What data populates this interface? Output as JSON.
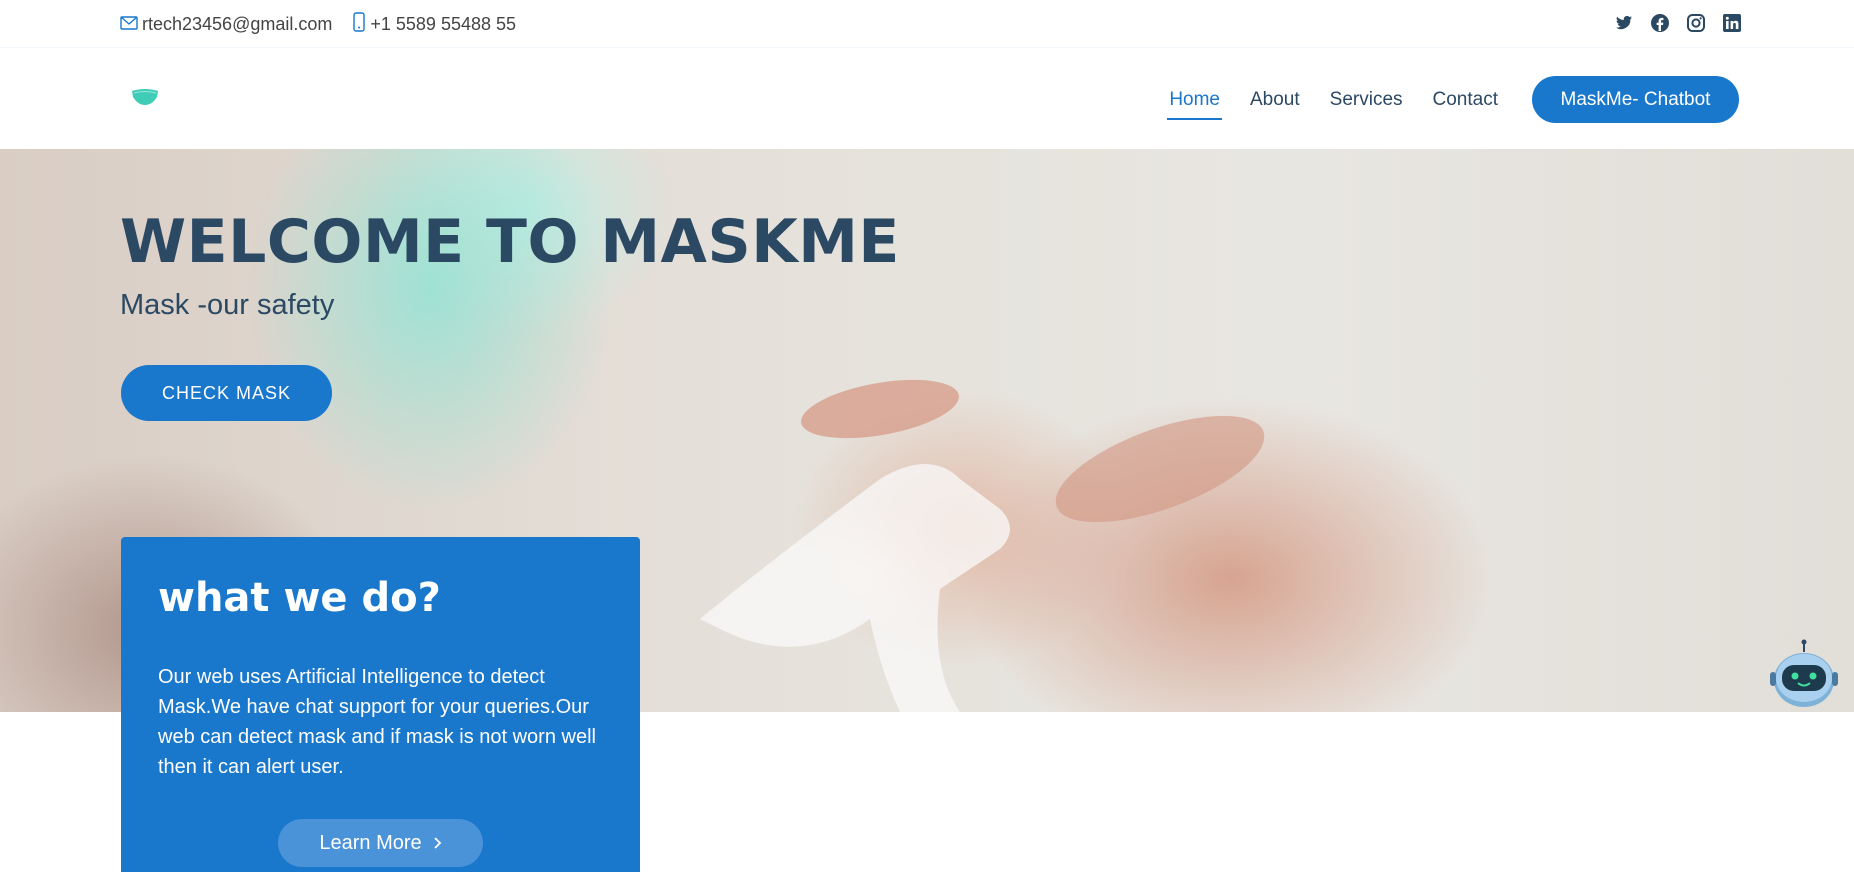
{
  "topbar": {
    "email": "rtech23456@gmail.com",
    "phone": "+1 5589 55488 55",
    "social_icons": [
      "twitter-icon",
      "facebook-icon",
      "instagram-icon",
      "linkedin-icon"
    ]
  },
  "header": {
    "nav": [
      {
        "label": "Home",
        "active": true
      },
      {
        "label": "About",
        "active": false
      },
      {
        "label": "Services",
        "active": false
      },
      {
        "label": "Contact",
        "active": false
      }
    ],
    "cta_label": "MaskMe- Chatbot"
  },
  "hero": {
    "title": "WELCOME TO MASKME",
    "subtitle": "Mask -our safety",
    "button_label": "CHECK MASK"
  },
  "what_we_do": {
    "title": "what we do?",
    "text": "Our web uses Artificial Intelligence to detect Mask.We have chat support for your queries.Our web can detect mask and if mask is not worn well then it can alert user.",
    "button_label": "Learn More",
    "button_icon": "chevron-right-icon"
  },
  "colors": {
    "accent": "#1977cc",
    "heading": "#2c4964",
    "logo": "#3fcdb8"
  }
}
